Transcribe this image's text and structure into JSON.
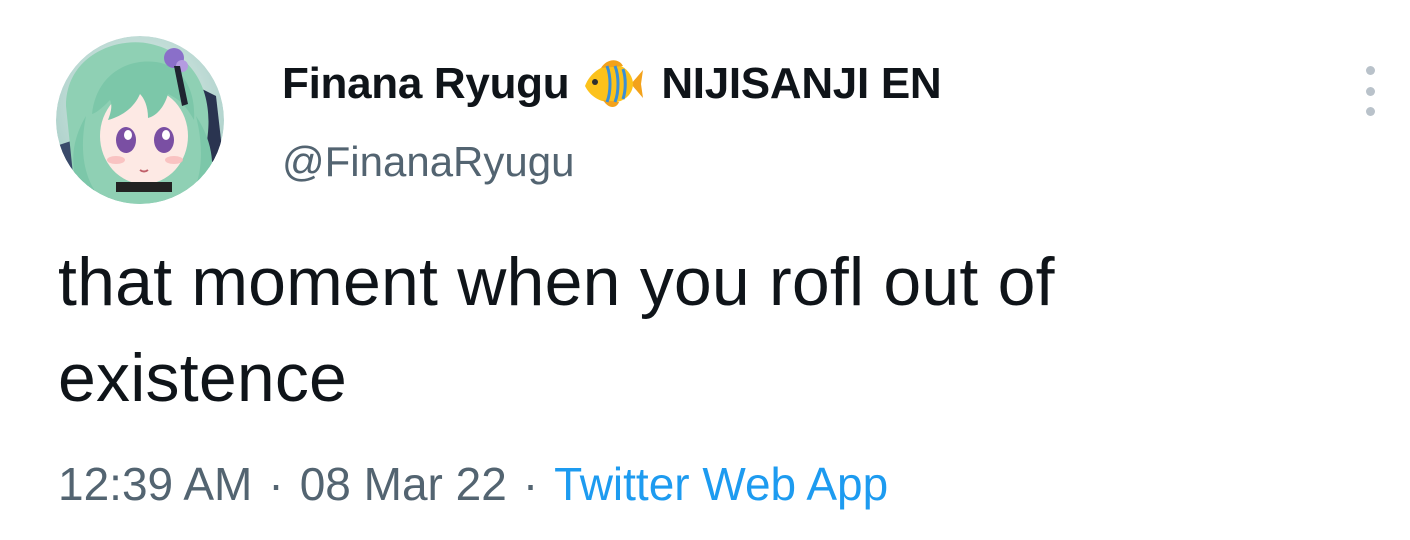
{
  "tweet": {
    "author": {
      "display_name": "Finana Ryugu",
      "name_emoji": "tropical-fish-emoji",
      "affiliation": "NIJISANJI EN",
      "handle": "@FinanaRyugu",
      "avatar": "anime-girl-avatar"
    },
    "text": "that moment when you rofl out of existence",
    "time": "12:39 AM",
    "date": "08 Mar 22",
    "separator": "·",
    "source": "Twitter Web App"
  },
  "icons": {
    "more": "more-options-icon"
  },
  "colors": {
    "text": "#0f1419",
    "secondary": "#536471",
    "link": "#1d9bf0",
    "background": "#ffffff"
  }
}
